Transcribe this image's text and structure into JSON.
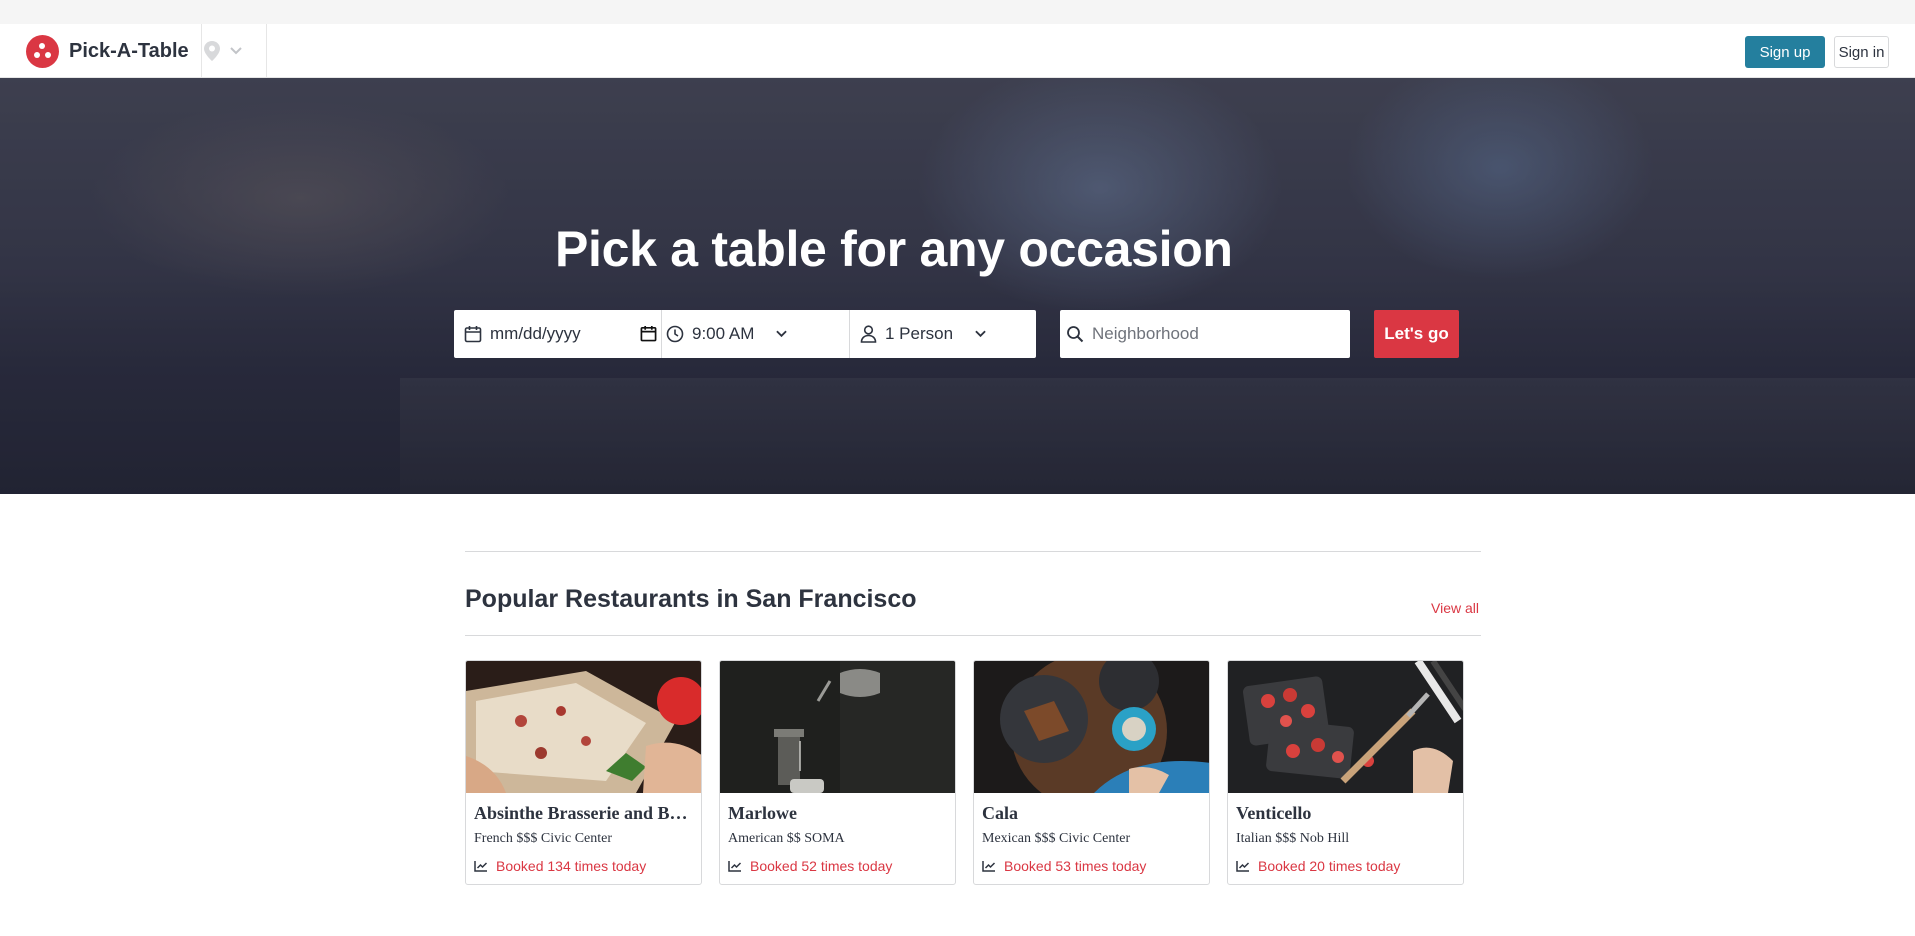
{
  "brand": {
    "name": "Pick-A-Table"
  },
  "header": {
    "signup_label": "Sign up",
    "signin_label": "Sign in"
  },
  "hero": {
    "title": "Pick a table for any occasion"
  },
  "search": {
    "date_placeholder": "mm/dd/yyyy",
    "time_value": "9:00 AM",
    "party_value": "1 Person",
    "neighborhood_placeholder": "Neighborhood",
    "submit_label": "Let's go"
  },
  "section": {
    "title": "Popular Restaurants in San Francisco",
    "view_all": "View all"
  },
  "restaurants": [
    {
      "name": "Absinthe Brasserie and B…",
      "meta": "French $$$ Civic Center",
      "booked": "Booked 134 times today"
    },
    {
      "name": "Marlowe",
      "meta": "American $$ SOMA",
      "booked": "Booked 52 times today"
    },
    {
      "name": "Cala",
      "meta": "Mexican $$$ Civic Center",
      "booked": "Booked 53 times today"
    },
    {
      "name": "Venticello",
      "meta": "Italian $$$ Nob Hill",
      "booked": "Booked 20 times today"
    }
  ],
  "colors": {
    "brand_red": "#da3743",
    "signup_blue": "#247f9e",
    "text": "#2d333f",
    "border": "#d8d9db"
  },
  "icons": [
    "logo-icon",
    "map-pin-icon",
    "chevron-down-icon",
    "calendar-icon",
    "clock-icon",
    "person-icon",
    "search-icon",
    "trending-icon"
  ]
}
